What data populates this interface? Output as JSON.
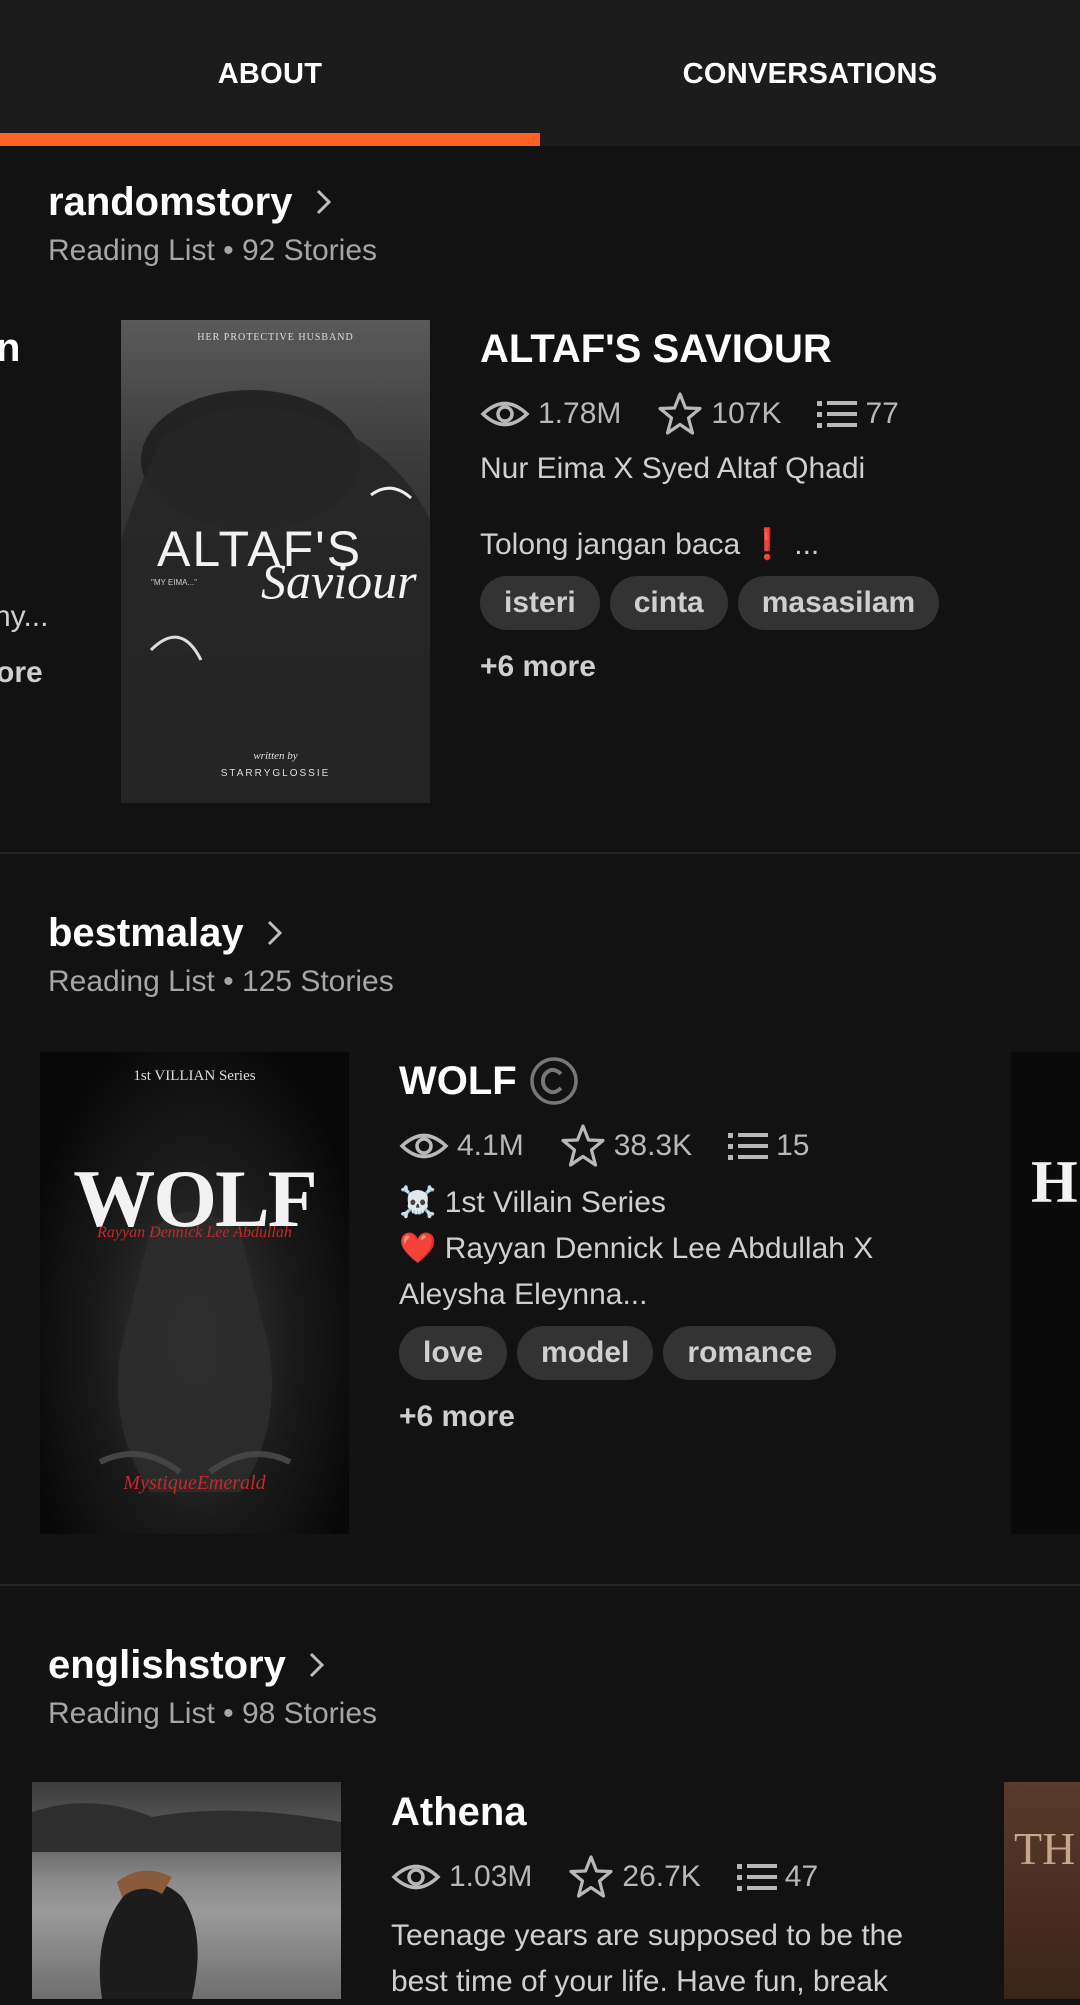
{
  "tabs": {
    "about": "ABOUT",
    "conversations": "CONVERSATIONS"
  },
  "lists": [
    {
      "name": "randomstory",
      "subtitle": "Reading List • 92 Stories",
      "story": {
        "title": "ALTAF'S SAVIOUR",
        "reads": "1.78M",
        "votes": "107K",
        "parts": "77",
        "desc_line1": "Nur Eima X Syed Altaf Qhadi",
        "desc_line2": "Tolong jangan baca ❗ ...",
        "tags": [
          "isteri",
          "cinta",
          "masasilam"
        ],
        "more": "+6 more",
        "cover": {
          "top": "HER PROTECTIVE HUSBAND",
          "main": "ALTAF'S",
          "script": "Saviour",
          "tagline": "\"MY EIMA...\"",
          "author_script": "written by",
          "author": "STARRYGLOSSIE"
        }
      },
      "left_edge": {
        "t1": "n",
        "t2": "ny...",
        "t3": "ore"
      }
    },
    {
      "name": "bestmalay",
      "subtitle": "Reading List • 125 Stories",
      "story": {
        "title": "WOLF",
        "reads": "4.1M",
        "votes": "38.3K",
        "parts": "15",
        "desc_line1": "☠️ 1st Villain Series",
        "desc_line2": "❤️ Rayyan Dennick Lee Abdullah X",
        "desc_line3": "Aleysha Eleynna...",
        "tags": [
          "love",
          "model",
          "romance"
        ],
        "more": "+6 more",
        "cover": {
          "top": "1st VILLIAN Series",
          "main": "WOLF",
          "script": "Rayyan Dennick Lee Abdullah",
          "author": "MystiqueEmerald"
        }
      },
      "right_edge": {
        "t1": "H"
      }
    },
    {
      "name": "englishstory",
      "subtitle": "Reading List • 98 Stories",
      "story": {
        "title": "Athena",
        "reads": "1.03M",
        "votes": "26.7K",
        "parts": "47",
        "desc_line1": "Teenage years are supposed to be the",
        "desc_line2": "best time of your life. Have fun, break"
      },
      "right_edge": {
        "t1": "TH"
      }
    }
  ],
  "colors": {
    "accent": "#ff6122",
    "background": "#121212",
    "tab_bar": "#1c1c1c",
    "tag": "#333333"
  },
  "icons": {
    "reads": "eye-icon",
    "votes": "star-icon",
    "parts": "list-icon",
    "nav": "chevron-right-icon",
    "completed": "copyright-icon"
  }
}
